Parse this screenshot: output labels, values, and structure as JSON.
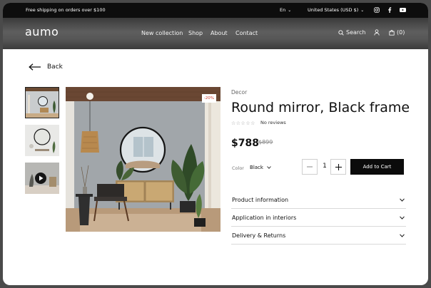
{
  "announcement": {
    "text": "Free shipping on orders over $100"
  },
  "topbar": {
    "language": "En",
    "region": "United States (USD $)"
  },
  "brand": {
    "logo": "aumo"
  },
  "nav": {
    "items": [
      "New collection",
      "Shop",
      "About",
      "Contact"
    ]
  },
  "header_actions": {
    "search_label": "Search",
    "cart_count": "(0)"
  },
  "back": {
    "label": "Back"
  },
  "product": {
    "category": "Decor",
    "title": "Round mirror, Black frame",
    "stars": "☆☆☆☆☆",
    "reviews": "No reviews",
    "price": "$788",
    "old_price": "$899",
    "discount_badge": "-20%",
    "color_label": "Color",
    "color_value": "Black",
    "quantity": "1",
    "add_to_cart": "Add to Cart"
  },
  "accordion": [
    {
      "label": "Product information"
    },
    {
      "label": "Application in interiors"
    },
    {
      "label": "Delivery & Returns"
    }
  ],
  "colors": {
    "accent": "#0b0b0b",
    "badge": "#d23b2b"
  },
  "icons": [
    "search-icon",
    "user-icon",
    "cart-icon",
    "instagram-icon",
    "facebook-icon",
    "youtube-icon",
    "back-arrow-icon",
    "play-icon",
    "chevron-down-icon",
    "minus-icon",
    "plus-icon"
  ]
}
